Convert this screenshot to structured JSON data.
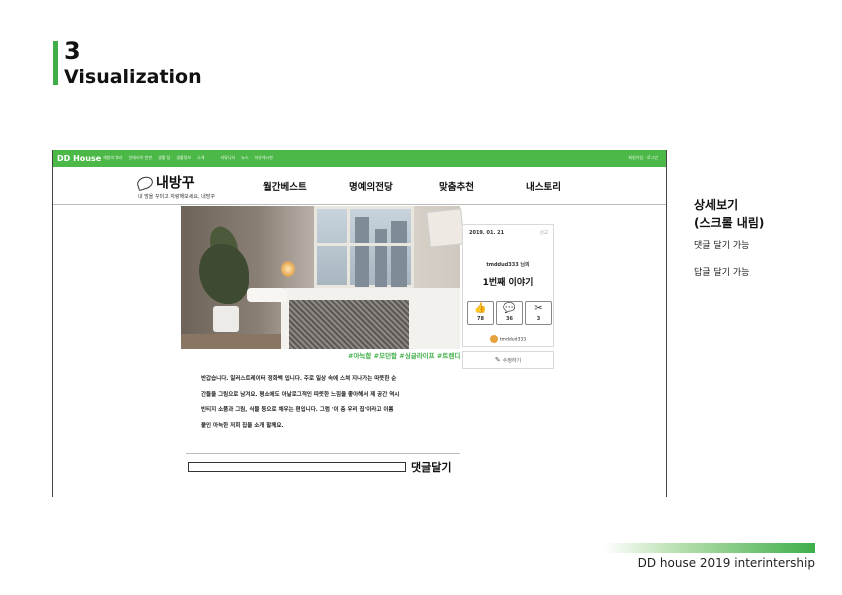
{
  "slide": {
    "number": "3",
    "title": "Visualization"
  },
  "app": {
    "logo": "DD House",
    "top_nav": [
      "체험의 뿌라",
      "인테리어 한판",
      "생활 팁",
      "생활정보",
      "소개",
      "커뮤니티",
      "뉴스",
      "자유게시판"
    ],
    "top_links": "회원가입 · 로그인",
    "brand_name": "내방꾸",
    "brand_tagline": "내 방을 꾸미고 자랑해보세요, 내방꾸",
    "main_nav": [
      "월간베스트",
      "명예의전당",
      "맞춤추천",
      "내스토리"
    ]
  },
  "post": {
    "date": "2019. 01. 21",
    "report": "신고",
    "author_line": "tmddud333 님의",
    "title": "1번째 이야기",
    "stats": [
      {
        "icon": "thumbs-up-icon",
        "glyph": "👍",
        "value": "78"
      },
      {
        "icon": "comment-icon",
        "glyph": "💬",
        "value": "36"
      },
      {
        "icon": "scrap-icon",
        "glyph": "✂",
        "value": "3"
      }
    ],
    "author_name": "tmddud333",
    "edit_label": "수정하기",
    "tags": "#아늑함 #모던함 #싱글라이프 #트렌디",
    "body": [
      "반갑습니다. 일러스트레이터 정화백 입니다. 주로 일상 속에 스쳐 지나가는 따뜻한 순",
      "간들을 그림으로 남겨요. 평소에도 아날로그적인 따뜻한 느낌을 좋아해서 제 공간 역시",
      "빈티지 소품과 그림, 식물 등으로 채우는 편입니다. 그럼 '이 층 우리 집'이라고 이름",
      "붙인 아늑한 저희 집을 소개 할께요."
    ],
    "comment_button": "댓글달기"
  },
  "notes": {
    "title_line1": "상세보기",
    "title_line2": "(스크롤 내림)",
    "item1": "댓글 달기 가능",
    "item2": "답글 달기 가능"
  },
  "footer": {
    "text": "DD house 2019 interintership"
  },
  "colors": {
    "accent": "#3fae49",
    "topbar": "#4cb848"
  }
}
